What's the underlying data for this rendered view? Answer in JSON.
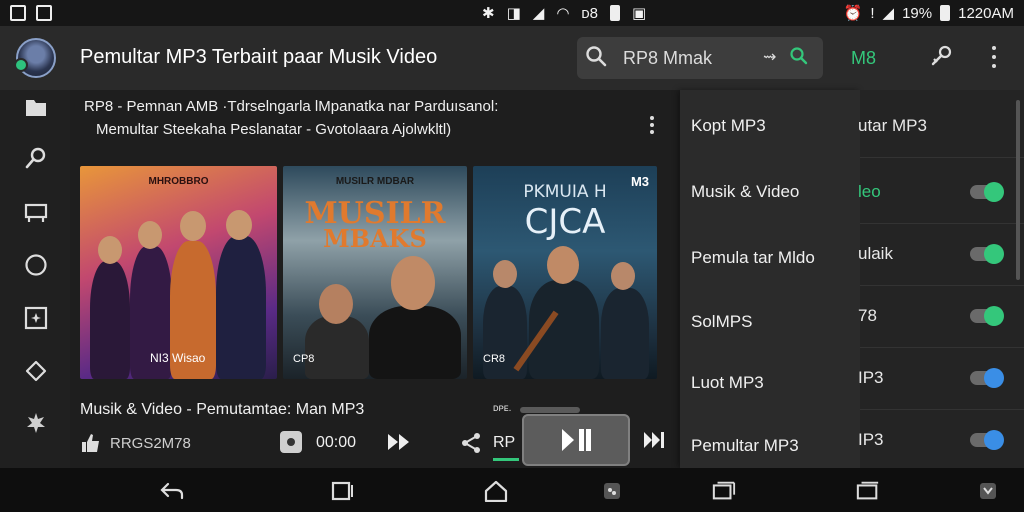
{
  "status_bar": {
    "center_text": "ᴅ8",
    "battery": "19%",
    "time": "1220AM"
  },
  "app_bar": {
    "title": "Pemultar MP3 Terbaiıt paar Musik Video",
    "search_value": "RP8 Mmak",
    "m8_label": "M8"
  },
  "description": {
    "line1": "RP8 - Pemnan AMB ·Tdrselngarla lMpanatka nar Parduısanol:",
    "line2": "Memultar Steekaha    Peslanatar  - Gvotolaara Ajolwkltl)"
  },
  "cards": [
    {
      "top_label": "MHROBBRO",
      "bottom_label": "NI3 Wisao"
    },
    {
      "top_label": "MUSILR MDBAR",
      "title_line1": "MUSILR",
      "title_line2": "MBAKS",
      "corner": "CP8"
    },
    {
      "top_label": "PKMUIA H",
      "title": "CJCA",
      "badge": "M3",
      "corner": "CR8"
    }
  ],
  "now_playing": {
    "title": "Musik & Video - Pemutamtae: Man MP3",
    "code": "RRGS2M78",
    "time": "00:00",
    "rp_label": "RP",
    "mini_label": "ᴅᴘᴇ."
  },
  "menu": {
    "items": [
      "Kopt MP3",
      "Musik & Video",
      "Pemula tar Mldo",
      "SolMPS",
      "Luot MP3",
      "Pemultar MP3"
    ]
  },
  "right_list": {
    "rows": [
      {
        "label": "utar MP3"
      },
      {
        "label": "leo"
      },
      {
        "label": "ulaik"
      },
      {
        "label": "78"
      },
      {
        "label": "IP3"
      },
      {
        "label": "IP3"
      }
    ]
  },
  "colors": {
    "accent_green": "#34c77b",
    "toggle_blue": "#3a8ee6",
    "background": "#1f1f1f"
  }
}
